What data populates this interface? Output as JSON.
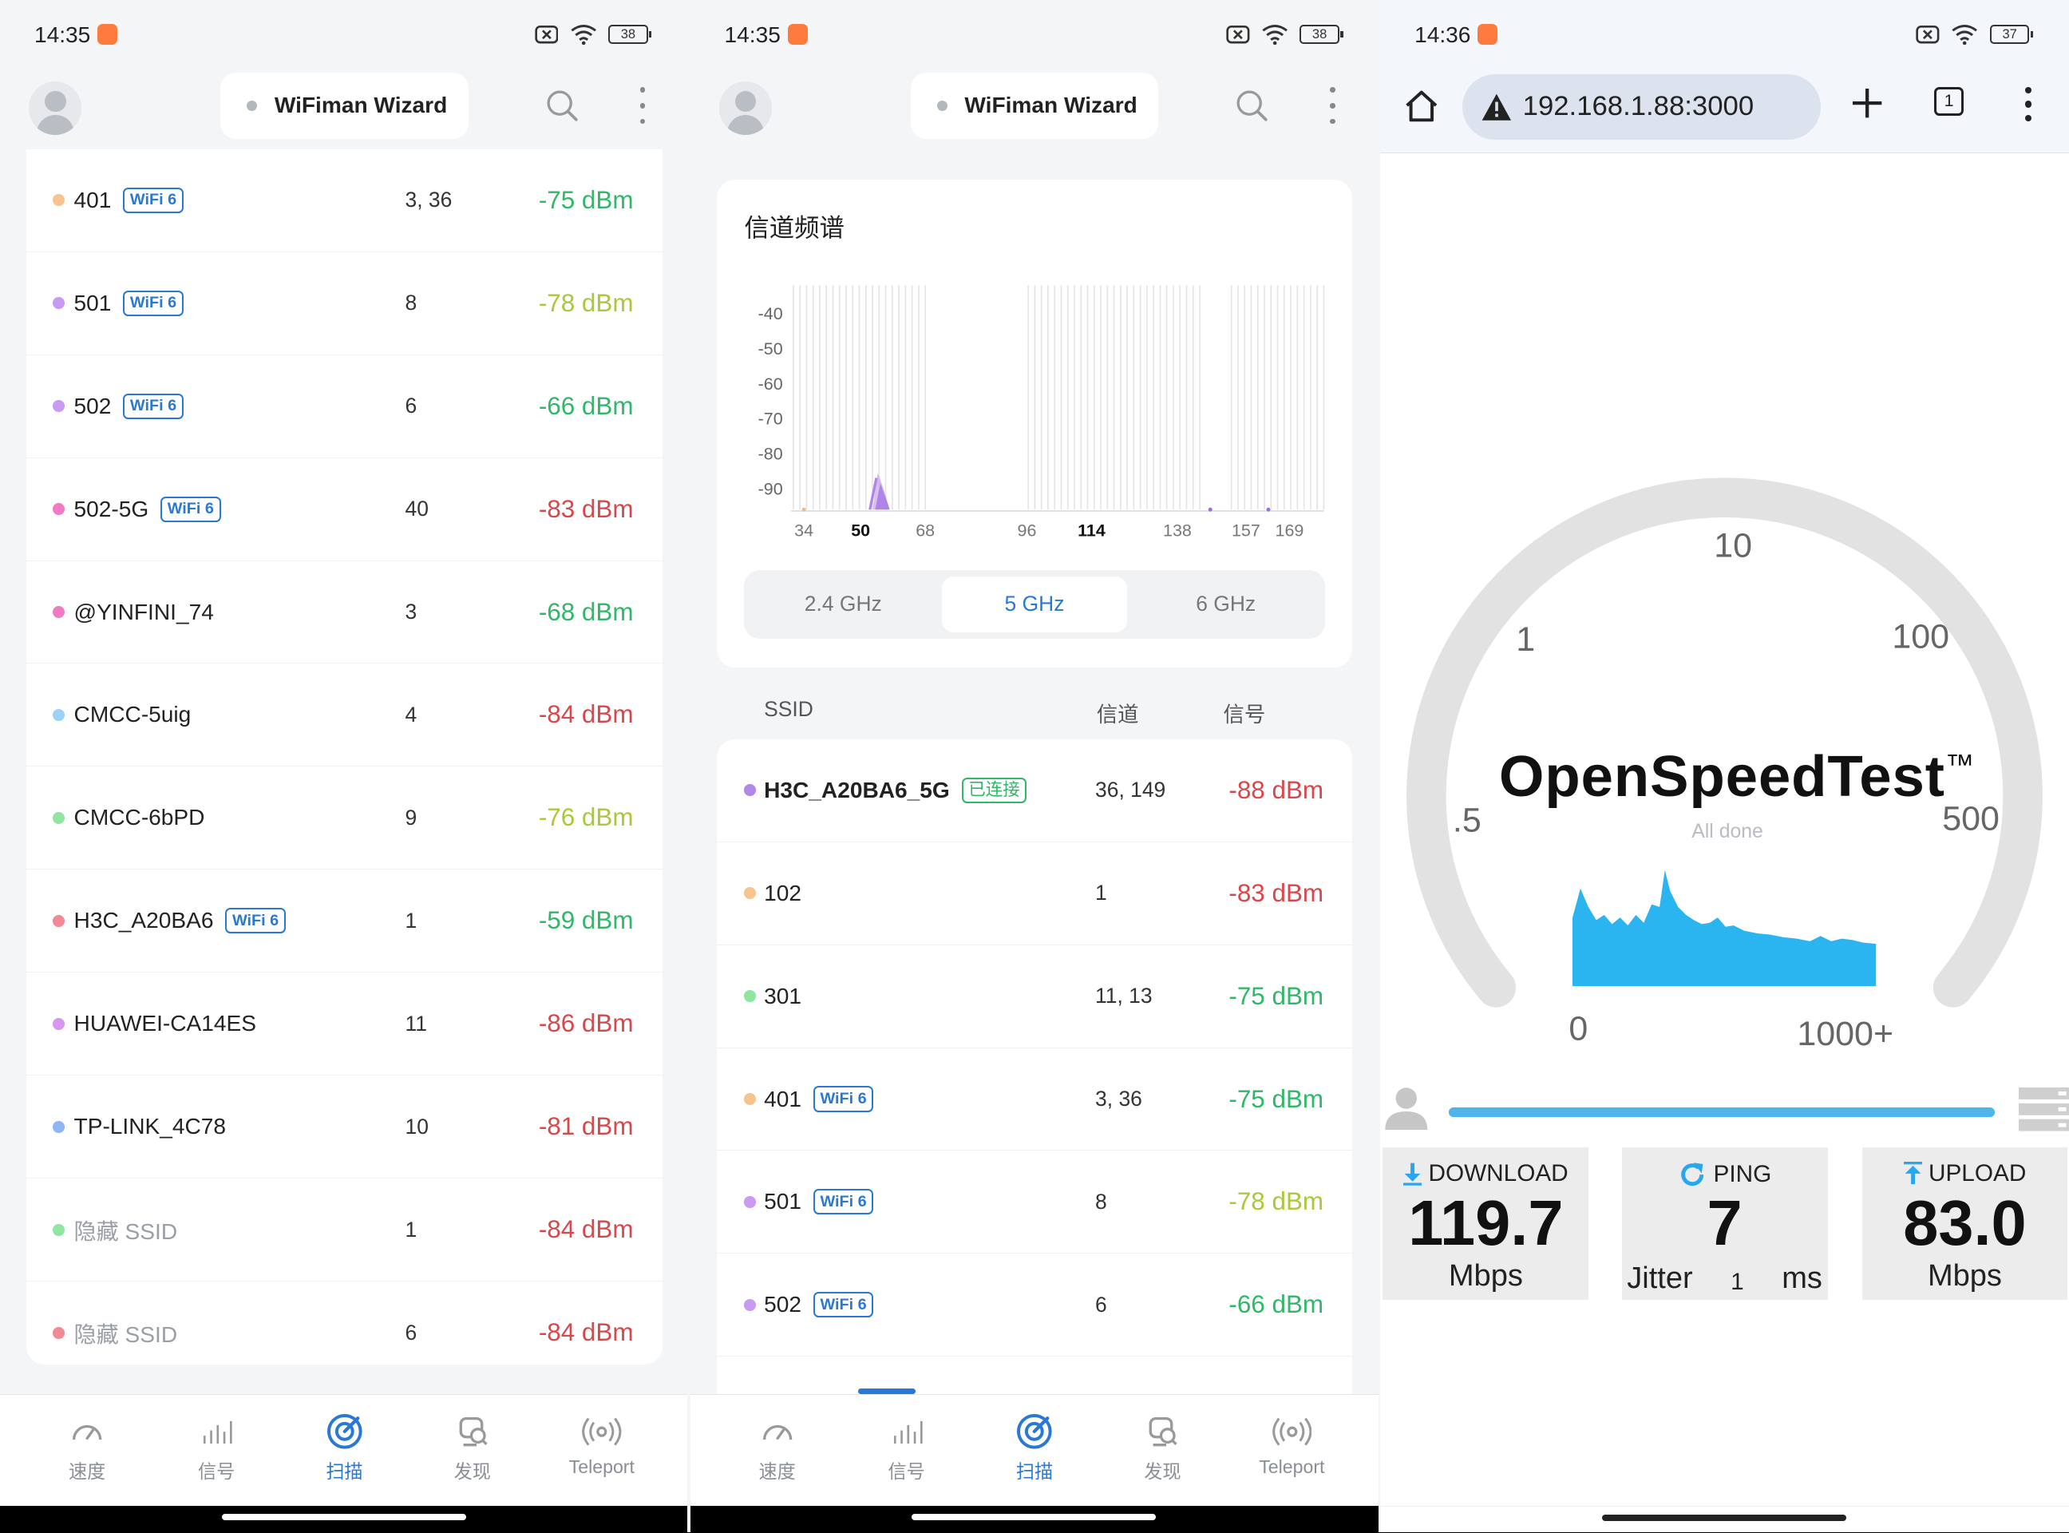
{
  "status_left": {
    "time": "14:35",
    "battery": "38"
  },
  "status_mid": {
    "time": "14:35",
    "battery": "38"
  },
  "status_right": {
    "time": "14:36",
    "battery": "37"
  },
  "app": {
    "title": "WiFiman Wizard"
  },
  "nav": [
    {
      "label": "速度",
      "icon": "speedometer-icon"
    },
    {
      "label": "信号",
      "icon": "signal-bars-icon"
    },
    {
      "label": "扫描",
      "icon": "radar-scan-icon",
      "active": true
    },
    {
      "label": "发现",
      "icon": "discover-icon"
    },
    {
      "label": "Teleport",
      "icon": "teleport-icon"
    }
  ],
  "colors": {
    "accent": "#2a78d6",
    "good": "#2fb868",
    "fair": "#a8c93a",
    "bad": "#d9474b"
  },
  "scan_list": [
    {
      "ssid": "401",
      "badge": "WiFi 6",
      "channel": "3, 36",
      "signal": "-75 dBm",
      "dot": "#f7c48f",
      "level": "good"
    },
    {
      "ssid": "501",
      "badge": "WiFi 6",
      "channel": "8",
      "signal": "-78 dBm",
      "dot": "#c89af2",
      "level": "fair"
    },
    {
      "ssid": "502",
      "badge": "WiFi 6",
      "channel": "6",
      "signal": "-66 dBm",
      "dot": "#c89af2",
      "level": "good"
    },
    {
      "ssid": "502-5G",
      "badge": "WiFi 6",
      "channel": "40",
      "signal": "-83 dBm",
      "dot": "#f07bc4",
      "level": "bad"
    },
    {
      "ssid": "@YINFINI_74",
      "badge": "",
      "channel": "3",
      "signal": "-68 dBm",
      "dot": "#f07bc4",
      "level": "good"
    },
    {
      "ssid": "CMCC-5uig",
      "badge": "",
      "channel": "4",
      "signal": "-84 dBm",
      "dot": "#9fd0f5",
      "level": "bad"
    },
    {
      "ssid": "CMCC-6bPD",
      "badge": "",
      "channel": "9",
      "signal": "-76 dBm",
      "dot": "#8ee6a0",
      "level": "fair"
    },
    {
      "ssid": "H3C_A20BA6",
      "badge": "WiFi 6",
      "channel": "1",
      "signal": "-59 dBm",
      "dot": "#f08a96",
      "level": "good"
    },
    {
      "ssid": "HUAWEI-CA14ES",
      "badge": "",
      "channel": "11",
      "signal": "-86 dBm",
      "dot": "#d896f0",
      "level": "bad"
    },
    {
      "ssid": "TP-LINK_4C78",
      "badge": "",
      "channel": "10",
      "signal": "-81 dBm",
      "dot": "#8fb6f2",
      "level": "bad"
    },
    {
      "ssid": "隐藏 SSID",
      "badge": "",
      "channel": "1",
      "signal": "-84 dBm",
      "dot": "#8ee6a0",
      "level": "bad",
      "hidden": true
    },
    {
      "ssid": "隐藏 SSID",
      "badge": "",
      "channel": "6",
      "signal": "-84 dBm",
      "dot": "#f08a96",
      "level": "bad",
      "hidden": true
    }
  ],
  "spectrum": {
    "title": "信道频谱",
    "y_ticks": [
      "-40",
      "-50",
      "-60",
      "-70",
      "-80",
      "-90"
    ],
    "x_ticks": [
      "34",
      "50",
      "68",
      "96",
      "114",
      "138",
      "157",
      "169"
    ],
    "bold_ticks": [
      "50",
      "114"
    ],
    "bands": [
      "2.4 GHz",
      "5 GHz",
      "6 GHz"
    ],
    "active_band": "5 GHz"
  },
  "table_header": {
    "ssid": "SSID",
    "channel": "信道",
    "signal": "信号"
  },
  "network_table": [
    {
      "ssid": "H3C_A20BA6_5G",
      "badge": "已连接",
      "badge_type": "connected",
      "channel": "36, 149",
      "signal": "-88 dBm",
      "dot": "#b088e8",
      "level": "bad",
      "bold": true
    },
    {
      "ssid": "102",
      "badge": "",
      "channel": "1",
      "signal": "-83 dBm",
      "dot": "#f7c48f",
      "level": "bad"
    },
    {
      "ssid": "301",
      "badge": "",
      "channel": "11, 13",
      "signal": "-75 dBm",
      "dot": "#8ee6a0",
      "level": "good"
    },
    {
      "ssid": "401",
      "badge": "WiFi 6",
      "channel": "3, 36",
      "signal": "-75 dBm",
      "dot": "#f7c48f",
      "level": "good"
    },
    {
      "ssid": "501",
      "badge": "WiFi 6",
      "channel": "8",
      "signal": "-78 dBm",
      "dot": "#c89af2",
      "level": "fair"
    },
    {
      "ssid": "502",
      "badge": "WiFi 6",
      "channel": "6",
      "signal": "-66 dBm",
      "dot": "#c89af2",
      "level": "good"
    }
  ],
  "browser": {
    "url": "192.168.1.88:3000",
    "tab_count": "1"
  },
  "speedtest": {
    "brand": "OpenSpeedTest",
    "trademark": "™",
    "status": "All done",
    "scale": [
      ".5",
      "1",
      "10",
      "100",
      "500",
      "0",
      "1000+"
    ],
    "download": {
      "label": "DOWNLOAD",
      "value": "119.7",
      "unit": "Mbps"
    },
    "ping": {
      "label": "PING",
      "value": "7",
      "jitter_label": "Jitter",
      "jitter_value": "1",
      "unit": "ms"
    },
    "upload": {
      "label": "UPLOAD",
      "value": "83.0",
      "unit": "Mbps"
    },
    "progress": 1.0
  }
}
